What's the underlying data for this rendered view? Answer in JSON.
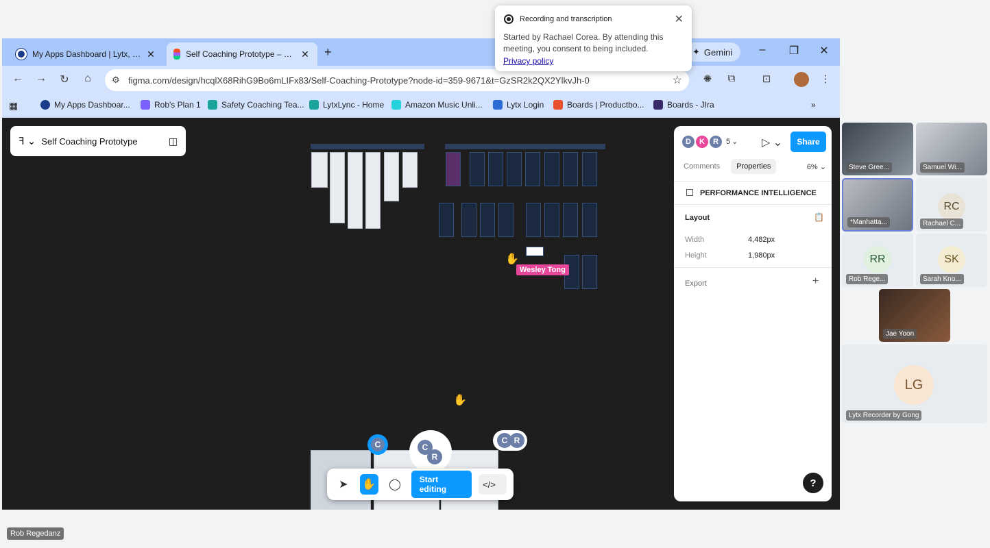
{
  "browser": {
    "tabs": [
      {
        "title": "My Apps Dashboard | Lytx, Inc.",
        "active": false,
        "favicon_color": "#1a3a8a"
      },
      {
        "title": "Self Coaching Prototype – Figma",
        "active": true,
        "favicon_color": "#f24e1e"
      }
    ],
    "gemini_label": "Gemini",
    "url": "figma.com/design/hcqlX68RihG9Bo6mLIFx83/Self-Coaching-Prototype?node-id=359-9671&t=GzSR2k2QX2YlkvJh-0",
    "bookmarks": [
      {
        "label": "My Apps Dashboar...",
        "color": "#1a3a8a"
      },
      {
        "label": "Rob's Plan 1",
        "color": "#7b61ff"
      },
      {
        "label": "Safety Coaching Tea...",
        "color": "#1aa39a"
      },
      {
        "label": "LytxLync - Home",
        "color": "#1aa39a"
      },
      {
        "label": "Amazon Music Unli...",
        "color": "#25d1da"
      },
      {
        "label": "Lytx Login",
        "color": "#2a6bd6"
      },
      {
        "label": "Boards | Productbo...",
        "color": "#e8502b"
      },
      {
        "label": "Boards - JIra",
        "color": "#3b2a6a"
      }
    ]
  },
  "figma": {
    "file_title": "Self Coaching Prototype",
    "cursor_user": "Wesley Tong",
    "toolbar": {
      "start_editing": "Start editing"
    },
    "collaborators_bottom": [
      "C",
      "C",
      "R",
      "C",
      "R"
    ],
    "panel": {
      "avatars": [
        {
          "initial": "D",
          "color": "#6b7fa8"
        },
        {
          "initial": "K",
          "color": "#e8479a"
        },
        {
          "initial": "R",
          "color": "#6b7fa8"
        }
      ],
      "avatar_count": "5",
      "share_label": "Share",
      "tabs": [
        "Comments",
        "Properties"
      ],
      "active_tab": "Properties",
      "zoom": "6%",
      "frame_name": "PERFORMANCE INTELLIGENCE",
      "layout_title": "Layout",
      "width_label": "Width",
      "width_value": "4,482px",
      "height_label": "Height",
      "height_value": "1,980px",
      "export_label": "Export",
      "help_label": "?"
    }
  },
  "notification": {
    "title": "Recording and transcription",
    "body": "Started by Rachael Corea. By attending this meeting, you consent to being included.",
    "link": "Privacy policy"
  },
  "meeting": {
    "participants": [
      {
        "name": "Steve Gree...",
        "type": "video"
      },
      {
        "name": "Samuel Wi...",
        "type": "video"
      },
      {
        "name": "*Manhatta...",
        "type": "video"
      },
      {
        "name": "Rachael C...",
        "initials": "RC",
        "bg": "#e9e2d6",
        "fg": "#5e4a2f"
      },
      {
        "name": "Rob Rege...",
        "initials": "RR",
        "bg": "#dff0df",
        "fg": "#2f5e37"
      },
      {
        "name": "Sarah Kno...",
        "initials": "SK",
        "bg": "#f4ecd2",
        "fg": "#6a5520"
      },
      {
        "name": "Jae Yoon",
        "type": "video"
      },
      {
        "name": "Lytx Recorder by Gong",
        "initials": "LG",
        "bg": "#f8e5d2",
        "fg": "#7a5530"
      }
    ],
    "self_name": "Rob Regedanz"
  }
}
